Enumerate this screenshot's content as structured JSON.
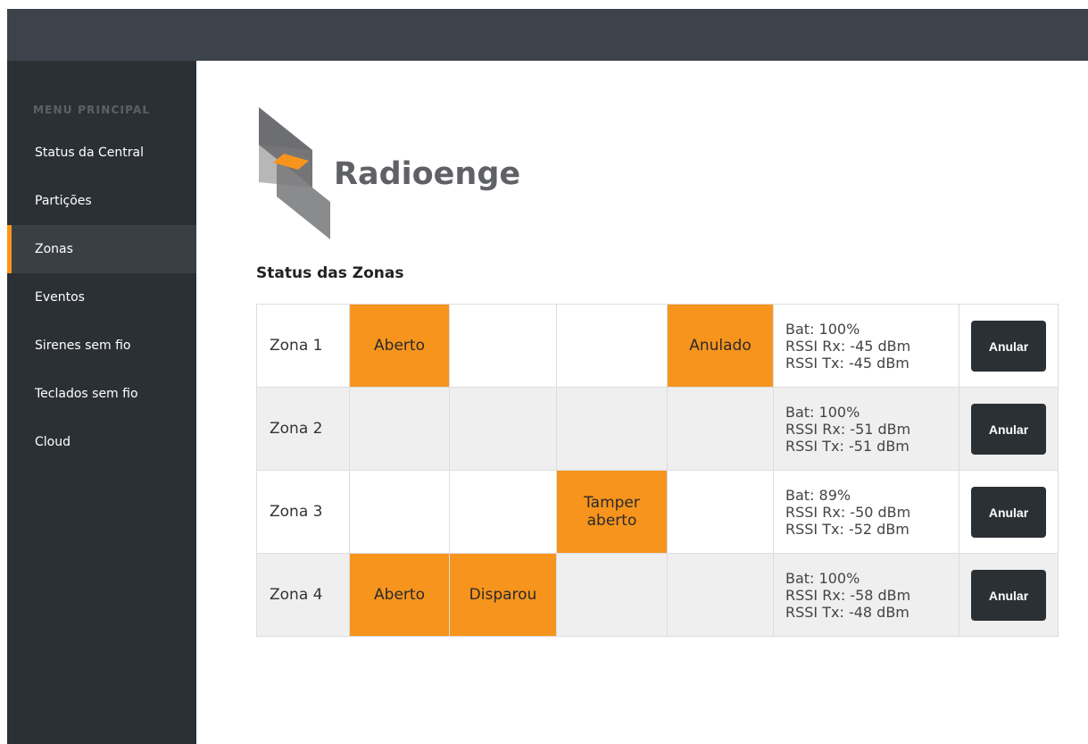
{
  "sidebar": {
    "header": "MENU PRINCIPAL",
    "items": [
      {
        "label": "Status da Central"
      },
      {
        "label": "Partições"
      },
      {
        "label": "Zonas",
        "active": true
      },
      {
        "label": "Eventos"
      },
      {
        "label": "Sirenes sem fio"
      },
      {
        "label": "Teclados sem fio"
      },
      {
        "label": "Cloud"
      }
    ]
  },
  "brand": {
    "name": "Radioenge",
    "accent": "#f7941d",
    "logo_gray": "#6d6e71"
  },
  "main": {
    "title": "Status das Zonas"
  },
  "zones": [
    {
      "name": "Zona 1",
      "c1": "Aberto",
      "c2": "",
      "c3": "",
      "c4": "Anulado",
      "bat": "Bat: 100%",
      "rx": "RSSI Rx: -45 dBm",
      "tx": "RSSI Tx: -45 dBm",
      "button": "Anular"
    },
    {
      "name": "Zona 2",
      "c1": "",
      "c2": "",
      "c3": "",
      "c4": "",
      "bat": "Bat: 100%",
      "rx": "RSSI Rx: -51 dBm",
      "tx": "RSSI Tx: -51 dBm",
      "button": "Anular"
    },
    {
      "name": "Zona 3",
      "c1": "",
      "c2": "",
      "c3": "Tamper aberto",
      "c4": "",
      "bat": "Bat: 89%",
      "rx": "RSSI Rx: -50 dBm",
      "tx": "RSSI Tx: -52 dBm",
      "button": "Anular"
    },
    {
      "name": "Zona 4",
      "c1": "Aberto",
      "c2": "Disparou",
      "c3": "",
      "c4": "",
      "bat": "Bat: 100%",
      "rx": "RSSI Rx: -58 dBm",
      "tx": "RSSI Tx: -48 dBm",
      "button": "Anular"
    }
  ]
}
